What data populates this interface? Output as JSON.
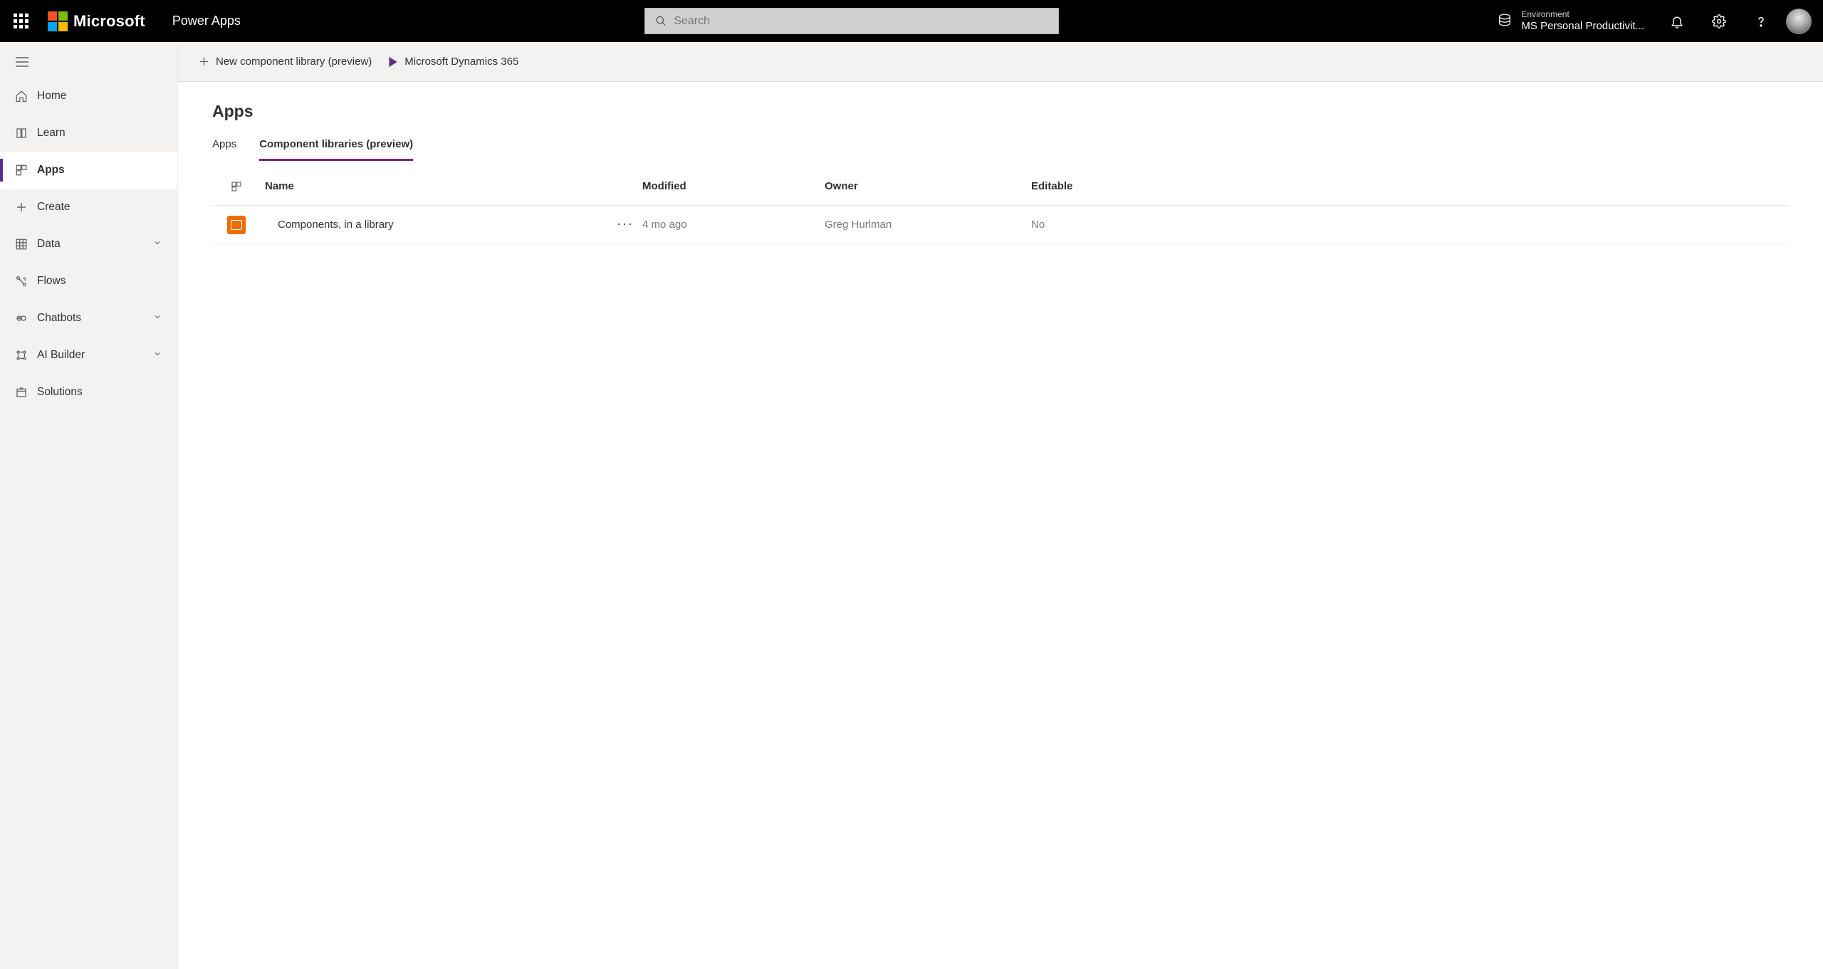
{
  "header": {
    "brand_word": "Microsoft",
    "app_title": "Power Apps",
    "search_placeholder": "Search",
    "environment_label": "Environment",
    "environment_name": "MS Personal Productivit..."
  },
  "sidebar": {
    "items": [
      {
        "label": "Home",
        "icon": "home",
        "selected": false,
        "expandable": false
      },
      {
        "label": "Learn",
        "icon": "book",
        "selected": false,
        "expandable": false
      },
      {
        "label": "Apps",
        "icon": "apps",
        "selected": true,
        "expandable": false
      },
      {
        "label": "Create",
        "icon": "plus",
        "selected": false,
        "expandable": false
      },
      {
        "label": "Data",
        "icon": "grid",
        "selected": false,
        "expandable": true
      },
      {
        "label": "Flows",
        "icon": "flow",
        "selected": false,
        "expandable": false
      },
      {
        "label": "Chatbots",
        "icon": "chat",
        "selected": false,
        "expandable": true
      },
      {
        "label": "AI Builder",
        "icon": "ai",
        "selected": false,
        "expandable": true
      },
      {
        "label": "Solutions",
        "icon": "package",
        "selected": false,
        "expandable": false
      }
    ]
  },
  "toolbar": {
    "new_component_library": "New component library (preview)",
    "dynamics_label": "Microsoft Dynamics 365"
  },
  "page": {
    "title": "Apps",
    "tabs": [
      {
        "label": "Apps",
        "active": false
      },
      {
        "label": "Component libraries (preview)",
        "active": true
      }
    ],
    "columns": {
      "name": "Name",
      "modified": "Modified",
      "owner": "Owner",
      "editable": "Editable"
    },
    "rows": [
      {
        "name": "Components, in a library",
        "modified": "4 mo ago",
        "owner": "Greg Hurlman",
        "editable": "No"
      }
    ]
  }
}
